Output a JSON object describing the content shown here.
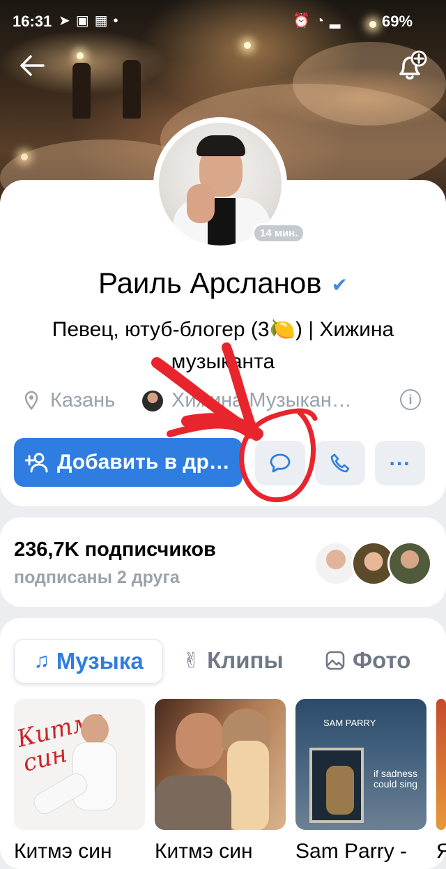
{
  "status_bar": {
    "time": "16:31",
    "battery": "69%"
  },
  "profile": {
    "online_badge": "14 мин.",
    "name": "Раиль Арсланов",
    "status": "Певец, ютуб-блогер (3🍋) | Хижина музыканта",
    "city": "Казань",
    "community": "Хижина Музыкан…"
  },
  "actions": {
    "add_friend": "Добавить в др…"
  },
  "followers": {
    "count": "236,7K подписчиков",
    "friends": "подписаны 2 друга"
  },
  "tabs": [
    {
      "label": "Музыка",
      "icon": "music-note-icon",
      "active": true
    },
    {
      "label": "Клипы",
      "icon": "clips-icon",
      "active": false
    },
    {
      "label": "Фото",
      "icon": "photo-icon",
      "active": false
    }
  ],
  "albums": [
    {
      "title": "Китмэ син",
      "cover_text": "Китмэ син"
    },
    {
      "title": "Китмэ син"
    },
    {
      "title": "Sam Parry -",
      "cover_text": "SAM PARRY",
      "cover_subtext": "if sadness could sing"
    },
    {
      "title": "Я"
    }
  ],
  "colors": {
    "accent": "#2f7de1",
    "secondary_text": "#99a2ad",
    "annotation": "#e8252d"
  }
}
